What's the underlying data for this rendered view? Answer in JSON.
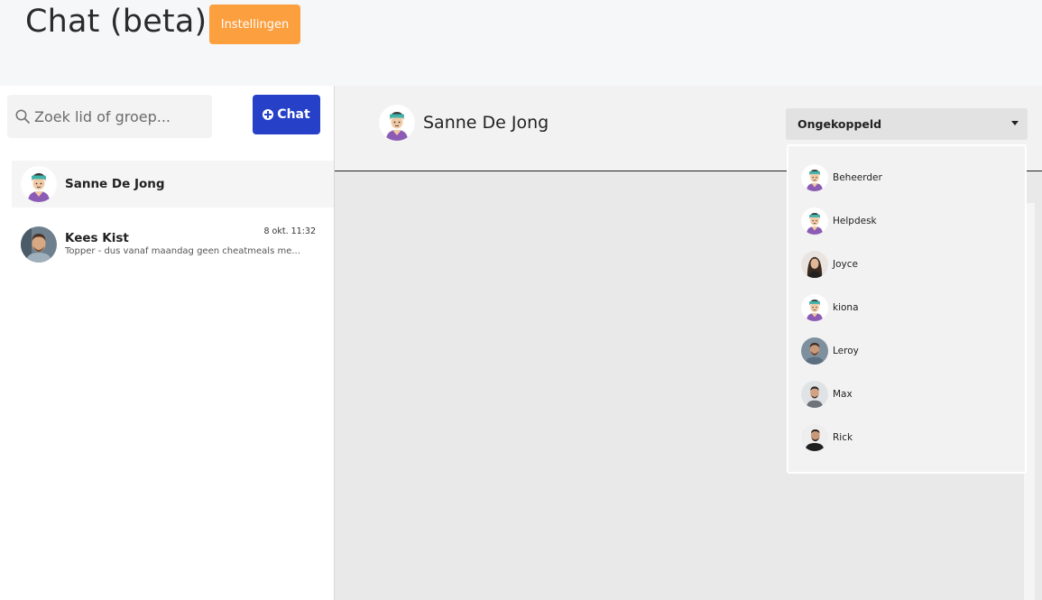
{
  "header": {
    "title": "Chat (beta)",
    "settings_label": "Instellingen"
  },
  "sidebar": {
    "search_placeholder": "Zoek lid of groep...",
    "new_chat_label": "Chat",
    "conversations": [
      {
        "name": "Sanne De Jong",
        "time": "",
        "preview": "",
        "avatar": "coach-avatar",
        "active": true
      },
      {
        "name": "Kees Kist",
        "time": "8 okt. 11:32",
        "preview": "Topper - dus vanaf maandag geen cheatmeals me...",
        "avatar": "photo-avatar",
        "active": false
      }
    ]
  },
  "chat": {
    "contact_name": "Sanne De Jong",
    "assign_select": {
      "value": "Ongekoppeld",
      "options": [
        "Beheerder",
        "Helpdesk",
        "Joyce",
        "kiona",
        "Leroy",
        "Max",
        "Rick"
      ]
    }
  },
  "colors": {
    "settings_button": "#fc9f3f",
    "chat_button": "#2641c8",
    "avatar_teal": "#3fa9a3",
    "avatar_purple": "#7b4fa3"
  }
}
